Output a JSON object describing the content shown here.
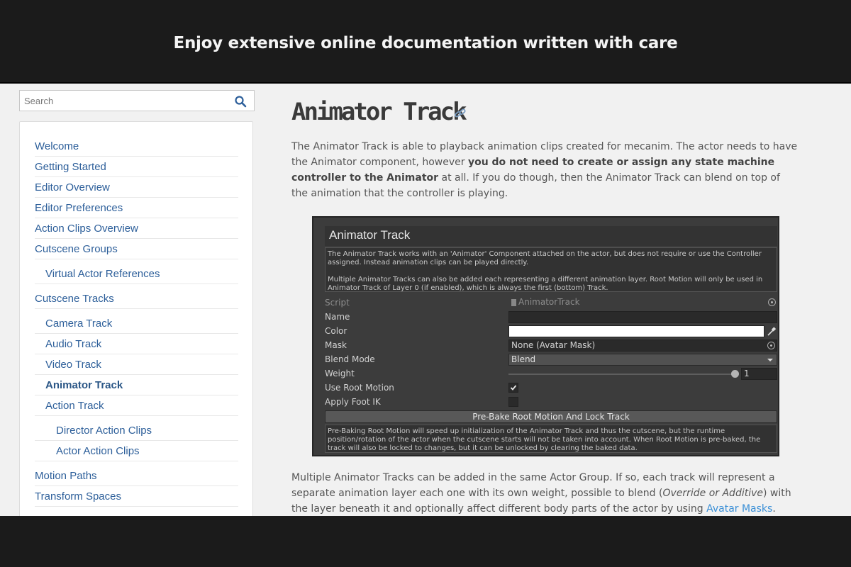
{
  "banner": {
    "title": "Enjoy extensive online documentation written with care"
  },
  "search": {
    "placeholder": "Search"
  },
  "sidebar": {
    "items": [
      {
        "label": "Welcome",
        "level": 1
      },
      {
        "label": "Getting Started",
        "level": 1
      },
      {
        "label": "Editor Overview",
        "level": 1
      },
      {
        "label": "Editor Preferences",
        "level": 1
      },
      {
        "label": "Action Clips Overview",
        "level": 1
      },
      {
        "label": "Cutscene Groups",
        "level": 1
      },
      {
        "label": "Virtual Actor References",
        "level": 2
      },
      {
        "label": "Cutscene Tracks",
        "level": 1
      },
      {
        "label": "Camera Track",
        "level": 2
      },
      {
        "label": "Audio Track",
        "level": 2
      },
      {
        "label": "Video Track",
        "level": 2
      },
      {
        "label": "Animator Track",
        "level": 2,
        "active": true
      },
      {
        "label": "Action Track",
        "level": 2
      },
      {
        "label": "Director Action Clips",
        "level": 3
      },
      {
        "label": "Actor Action Clips",
        "level": 3
      },
      {
        "label": "Motion Paths",
        "level": 1
      },
      {
        "label": "Transform Spaces",
        "level": 1
      }
    ]
  },
  "article": {
    "title": "Animator Track",
    "para1": {
      "text_a": "The Animator Track is able to playback animation clips created for mecanim. The actor needs to have the Animator component, however ",
      "bold": "you do not need to create or assign any state machine controller to the Animator",
      "text_b": " at all. If you do though, then the Animator Track can blend on top of the animation that the controller is playing."
    },
    "para2": {
      "text_a": "Multiple Animator Tracks can be added in the same Actor Group. If so, each track will represent a separate animation layer each one with its own weight, possible to blend (",
      "italic": "Override or Additive",
      "text_b": ") with the layer beneath it and optionally affect different body parts of the actor by using ",
      "link": "Avatar Masks",
      "text_c": "."
    }
  },
  "inspector": {
    "title": "Animator Track",
    "help_top_1": "The Animator Track works with an 'Animator' Component attached on the actor, but does not require or use the Controller assigned. Instead animation clips can be played directly.",
    "help_top_2": "Multiple Animator Tracks can also be added each representing a different animation layer. Root Motion will only be used in Animator Track of Layer 0 (if enabled), which is always the first (bottom) Track.",
    "labels": {
      "script": "Script",
      "name": "Name",
      "color": "Color",
      "mask": "Mask",
      "blend_mode": "Blend Mode",
      "weight": "Weight",
      "use_root_motion": "Use Root Motion",
      "apply_foot_ik": "Apply Foot IK"
    },
    "values": {
      "script": "AnimatorTrack",
      "name": "",
      "color": "#ffffff",
      "mask": "None (Avatar Mask)",
      "blend_mode": "Blend",
      "weight": "1",
      "weight_fraction": 1,
      "use_root_motion": true,
      "apply_foot_ik": false
    },
    "button": "Pre-Bake Root Motion And Lock Track",
    "help_bottom": "Pre-Baking Root Motion will speed up initialization of the Animator Track and thus the cutscene, but the runtime position/rotation of the actor when the cutscene starts will not be taken into account. When Root Motion is pre-baked, the track will also be locked to changes, but it can be unlocked by clearing the baked data."
  },
  "colors": {
    "banner_bg": "#1b1b1b",
    "page_bg": "#f1f1f1",
    "nav_link": "#2d5f9a",
    "body_link": "#3a8fd6",
    "inspector_bg": "#3c3c3c"
  }
}
